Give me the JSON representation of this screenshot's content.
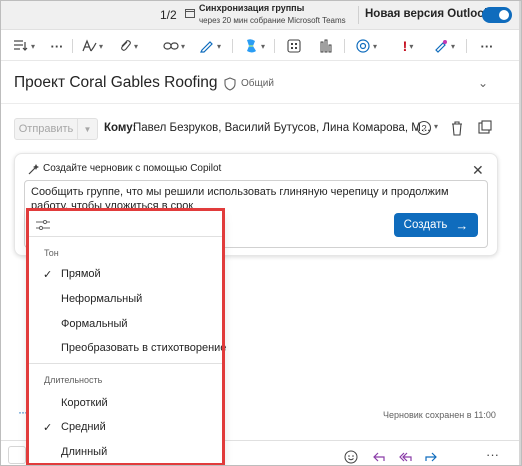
{
  "topbar": {
    "pager": "1/2",
    "sync_title": "Синхронизация группы",
    "sync_subtitle": "через 20 мин собрание Microsoft Teams",
    "new_outlook_label": "Новая версия Outlook",
    "new_outlook_toggle_on": true,
    "accent": "#0f6cbd"
  },
  "ribbon": {
    "icons": [
      "text-format-icon",
      "more-icon",
      "font-icon",
      "attach-icon",
      "link-icon",
      "signature-icon",
      "copilot-icon",
      "apps-icon",
      "insights-icon",
      "loop-icon",
      "importance-icon",
      "format-painter-icon",
      "more-icon"
    ]
  },
  "subject": {
    "title": "Проект Coral Gables Roofing",
    "shared_label": "Общий"
  },
  "compose": {
    "send_label": "Отправить",
    "to_label": "Кому:",
    "to_value": "Павел Безруков, Василий Бутусов, Лина Комарова, М..."
  },
  "copilot": {
    "title": "Создайте черновик с помощью Copilot",
    "prompt": "Сообщить группе, что мы решили использовать глиняную черепицу и продолжим работу, чтобы уложиться в срок",
    "create_label": "Создать"
  },
  "menu": {
    "tone_header": "Тон",
    "tone_items": [
      {
        "label": "Прямой",
        "checked": true
      },
      {
        "label": "Неформальный",
        "checked": false
      },
      {
        "label": "Формальный",
        "checked": false
      },
      {
        "label": "Преобразовать в стихотворение",
        "checked": false
      }
    ],
    "length_header": "Длительность",
    "length_items": [
      {
        "label": "Короткий",
        "checked": false
      },
      {
        "label": "Средний",
        "checked": true
      },
      {
        "label": "Длинный",
        "checked": false
      }
    ],
    "highlight_color": "#e13b3b"
  },
  "status": {
    "draft_saved": "Черновик сохранен в 11:00"
  }
}
